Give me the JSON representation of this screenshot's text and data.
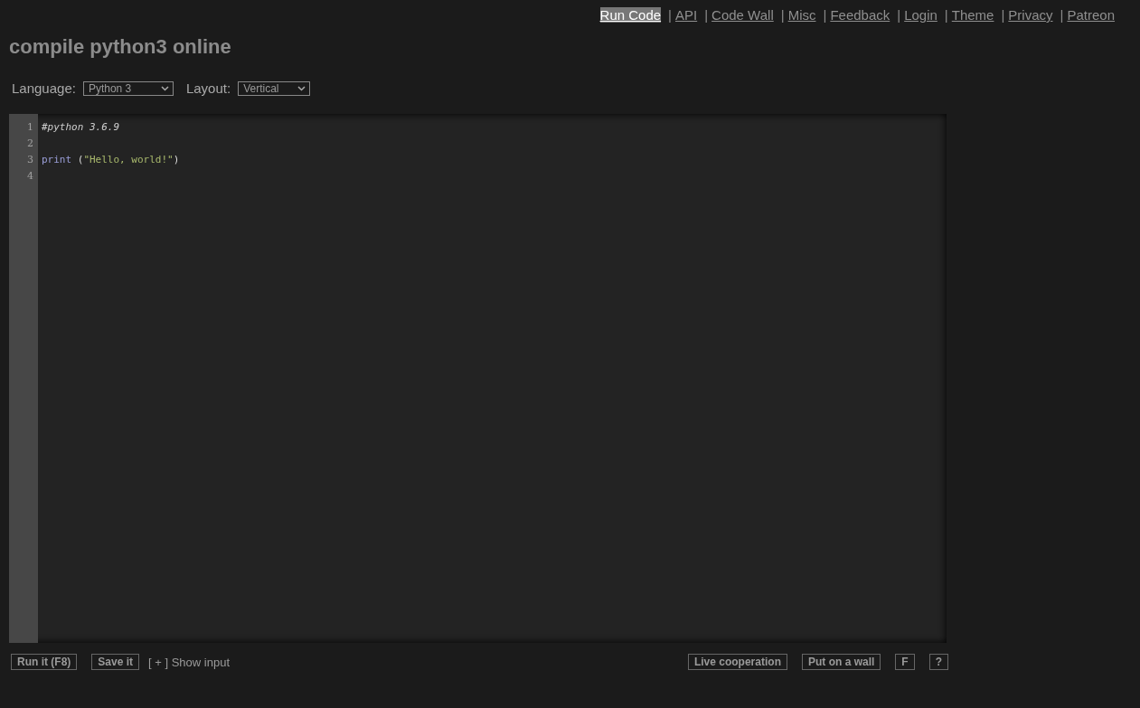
{
  "nav": [
    {
      "label": "Run Code",
      "selected": true
    },
    {
      "separator": "|",
      "label": "API",
      "selected": false
    },
    {
      "separator": "|",
      "label": "Code Wall",
      "selected": false
    },
    {
      "separator": "|",
      "label": "Misc",
      "selected": false
    },
    {
      "separator": "|",
      "label": "Feedback",
      "selected": false
    },
    {
      "separator": "|",
      "label": "Login",
      "selected": false
    },
    {
      "separator": "|",
      "label": "Theme",
      "selected": false
    },
    {
      "separator": "|",
      "label": "Privacy",
      "selected": false
    },
    {
      "separator": "|",
      "label": "Patreon",
      "selected": false
    }
  ],
  "title": "compile python3 online",
  "options": [
    {
      "label": "Language:",
      "value": "Python 3"
    },
    {
      "label": "Layout:",
      "value": "Vertical"
    }
  ],
  "editor": {
    "lines": [
      {
        "number": "1",
        "tokens": [
          {
            "kind": "comment",
            "text": "#python 3.6.9"
          }
        ]
      },
      {
        "number": "2"
      },
      {
        "number": "3",
        "tokens": [
          {
            "kind": "keyword",
            "text": "print"
          },
          {
            "kind": "plain",
            "text": " ("
          },
          {
            "kind": "string",
            "text": "\"Hello, world!\""
          },
          {
            "kind": "plain",
            "text": ")"
          }
        ]
      },
      {
        "number": "4"
      }
    ]
  },
  "left_actions": [
    {
      "kind": "button",
      "label": "Run it (F8)"
    },
    {
      "kind": "button",
      "label": "Save it"
    },
    {
      "kind": "link",
      "label": "[ + ] Show input"
    }
  ],
  "right_actions": [
    {
      "kind": "button",
      "label": "Live cooperation"
    },
    {
      "kind": "button",
      "label": "Put on a wall"
    },
    {
      "kind": "button",
      "label": "F"
    },
    {
      "kind": "button",
      "label": "?"
    }
  ]
}
